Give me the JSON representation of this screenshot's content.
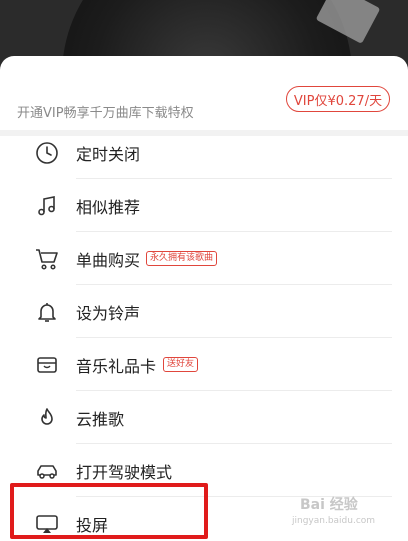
{
  "vip": {
    "promo_text": "开通VIP畅享千万曲库下载特权",
    "button_label": "VIP仅¥0.27/天"
  },
  "menu": {
    "items": [
      {
        "label": "定时关闭",
        "icon": "clock-icon"
      },
      {
        "label": "相似推荐",
        "icon": "music-notes-icon"
      },
      {
        "label": "单曲购买",
        "icon": "shopping-cart-icon",
        "tag": "永久拥有该歌曲"
      },
      {
        "label": "设为铃声",
        "icon": "bell-icon"
      },
      {
        "label": "音乐礼品卡",
        "icon": "gift-card-icon",
        "tag": "送好友"
      },
      {
        "label": "云推歌",
        "icon": "cloud-flame-icon"
      },
      {
        "label": "打开驾驶模式",
        "icon": "car-icon"
      },
      {
        "label": "投屏",
        "icon": "cast-screen-icon"
      }
    ]
  },
  "watermark": {
    "text": "Bai 经验",
    "sub": "jingyan.baidu.com"
  },
  "colors": {
    "accent": "#e0463c",
    "highlight": "#e01b1b"
  }
}
